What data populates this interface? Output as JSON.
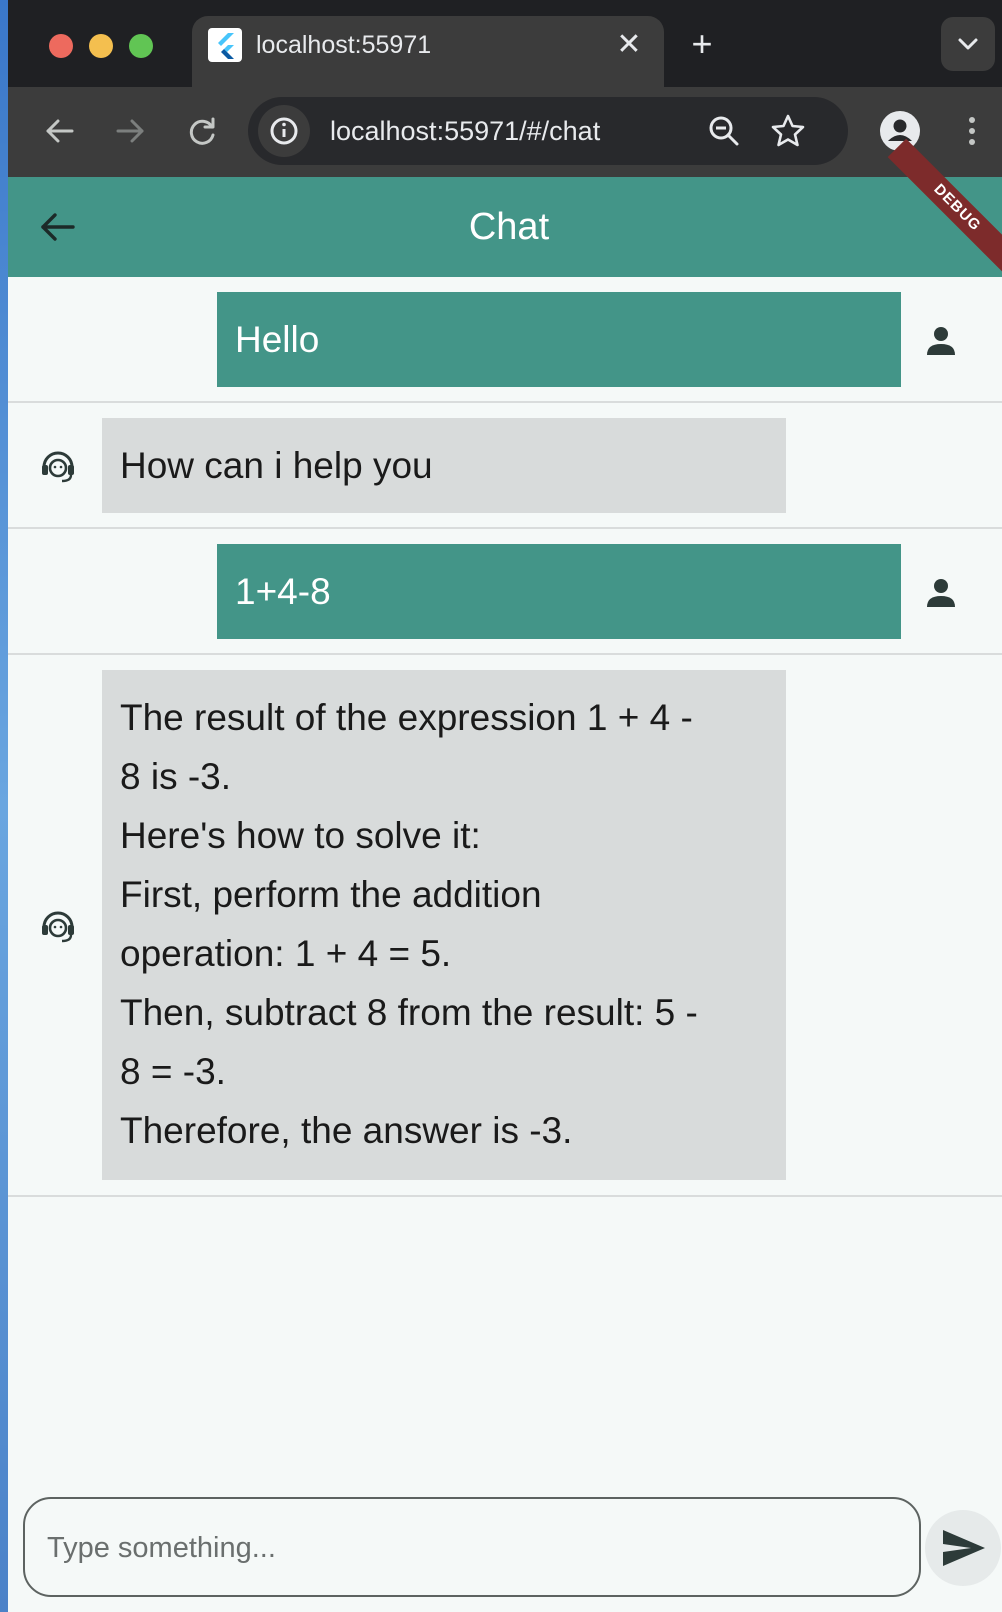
{
  "browser": {
    "tab_title": "localhost:55971",
    "url": "localhost:55971/#/chat",
    "icons": {
      "close_tab": "close-icon",
      "new_tab": "plus-icon",
      "tab_search": "chevron-down-icon",
      "back": "arrow-left-icon",
      "forward": "arrow-right-icon",
      "reload": "reload-icon",
      "site_info": "info-icon",
      "zoom": "zoom-out-icon",
      "bookmark": "star-icon",
      "profile": "profile-icon",
      "menu": "kebab-menu-icon"
    }
  },
  "app": {
    "title": "Chat",
    "debug_banner": "DEBUG",
    "accent_color": "#439588",
    "bot_bubble_color": "#d8dbdb"
  },
  "messages": [
    {
      "sender": "user",
      "lines": [
        "Hello"
      ]
    },
    {
      "sender": "bot",
      "lines": [
        "How can i help you"
      ]
    },
    {
      "sender": "user",
      "lines": [
        "1+4-8"
      ]
    },
    {
      "sender": "bot",
      "lines": [
        "The result of the expression 1 + 4 -",
        "8 is -3.",
        "Here's how to solve it:",
        "First, perform the addition",
        "operation: 1 + 4 = 5.",
        "Then, subtract 8 from the result: 5 -",
        "8 = -3.",
        "Therefore, the answer is -3."
      ]
    }
  ],
  "composer": {
    "placeholder": "Type something...",
    "value": ""
  }
}
